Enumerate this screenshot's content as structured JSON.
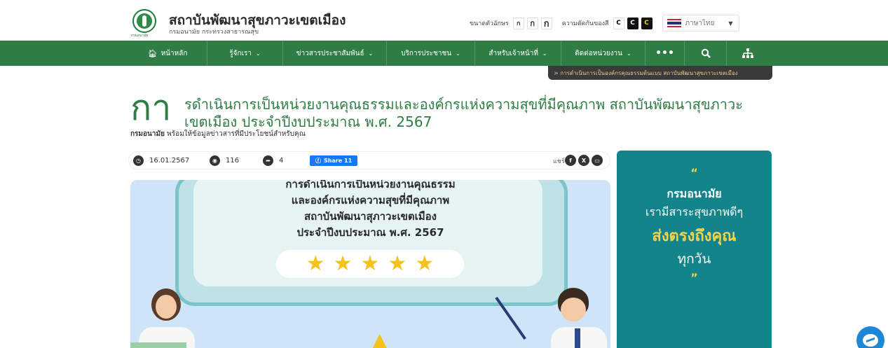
{
  "header": {
    "site_title": "สถาบันพัฒนาสุขภาวะเขตเมือง",
    "site_subtitle": "กรมอนามัย กระทรวงสาธารณสุข",
    "logo_caption": "กรมอนามัย",
    "font_size_label": "ขนาดตัวอักษร",
    "font_sizes": [
      "ก",
      "ก",
      "ก"
    ],
    "contrast_label": "ความตัดกันของสี",
    "contrast_options": [
      "C",
      "C",
      "C"
    ],
    "language": "ภาษาไทย"
  },
  "nav": {
    "items": [
      {
        "label": "หน้าหลัก",
        "icon": "home-icon"
      },
      {
        "label": "รู้จักเรา"
      },
      {
        "label": "ข่าวสารประชาสัมพันธ์"
      },
      {
        "label": "บริการประชาชน"
      },
      {
        "label": "สำหรับเจ้าหน้าที่"
      },
      {
        "label": "ติดต่อหน่วยงาน"
      }
    ],
    "more": "•••",
    "search_icon": "search-icon",
    "sitemap_icon": "sitemap-icon"
  },
  "breadcrumb": "> การดำเนินการเป็นองค์กรคุณธรรมต้นแบบ สถาบันพัฒนาสุขภาวะเขตเมือง",
  "article": {
    "title_first_letters": "กา",
    "title_line1": "รดำเนินการเป็นหน่วยงานคุณธรรมและองค์กรแห่งความสุขที่มีคุณภาพ สถาบันพัฒนาสุขภาวะ",
    "title_line2": "เขตเมือง ประจำปีงบประมาณ พ.ศ. 2567",
    "sub_strong": "กรมอนามัย",
    "sub_rest": " พร้อมให้ข้อมูลข่าวสารที่มีประโยชน์สำหรับคุณ",
    "date": "16.01.2567",
    "views": "116",
    "shares": "4",
    "fb_share": "Share 11",
    "share_label": "แชร์"
  },
  "hero": {
    "line1": "การดำเนินการเป็นหน่วยงานคุณธรรม",
    "line2": "และองค์กรแห่งความสุขที่มีคุณภาพ",
    "line3": "สถาบันพัฒนาสุภาวะเขตเมือง",
    "line4": "ประจำปีงบประมาณ พ.ศ. 2567",
    "stars": 5
  },
  "panel": {
    "open_quote": "“",
    "line1": "กรมอนามัย",
    "line2": "เรามีสาระสุขภาพดีๆ",
    "line3": "ส่งตรงถึงคุณ",
    "line4": "ทุกวัน",
    "close_quote": "”"
  },
  "colors": {
    "primary_green": "#2f7d45",
    "panel_teal": "#13848a",
    "accent_yellow": "#f2d34c",
    "facebook_blue": "#1877f2"
  }
}
